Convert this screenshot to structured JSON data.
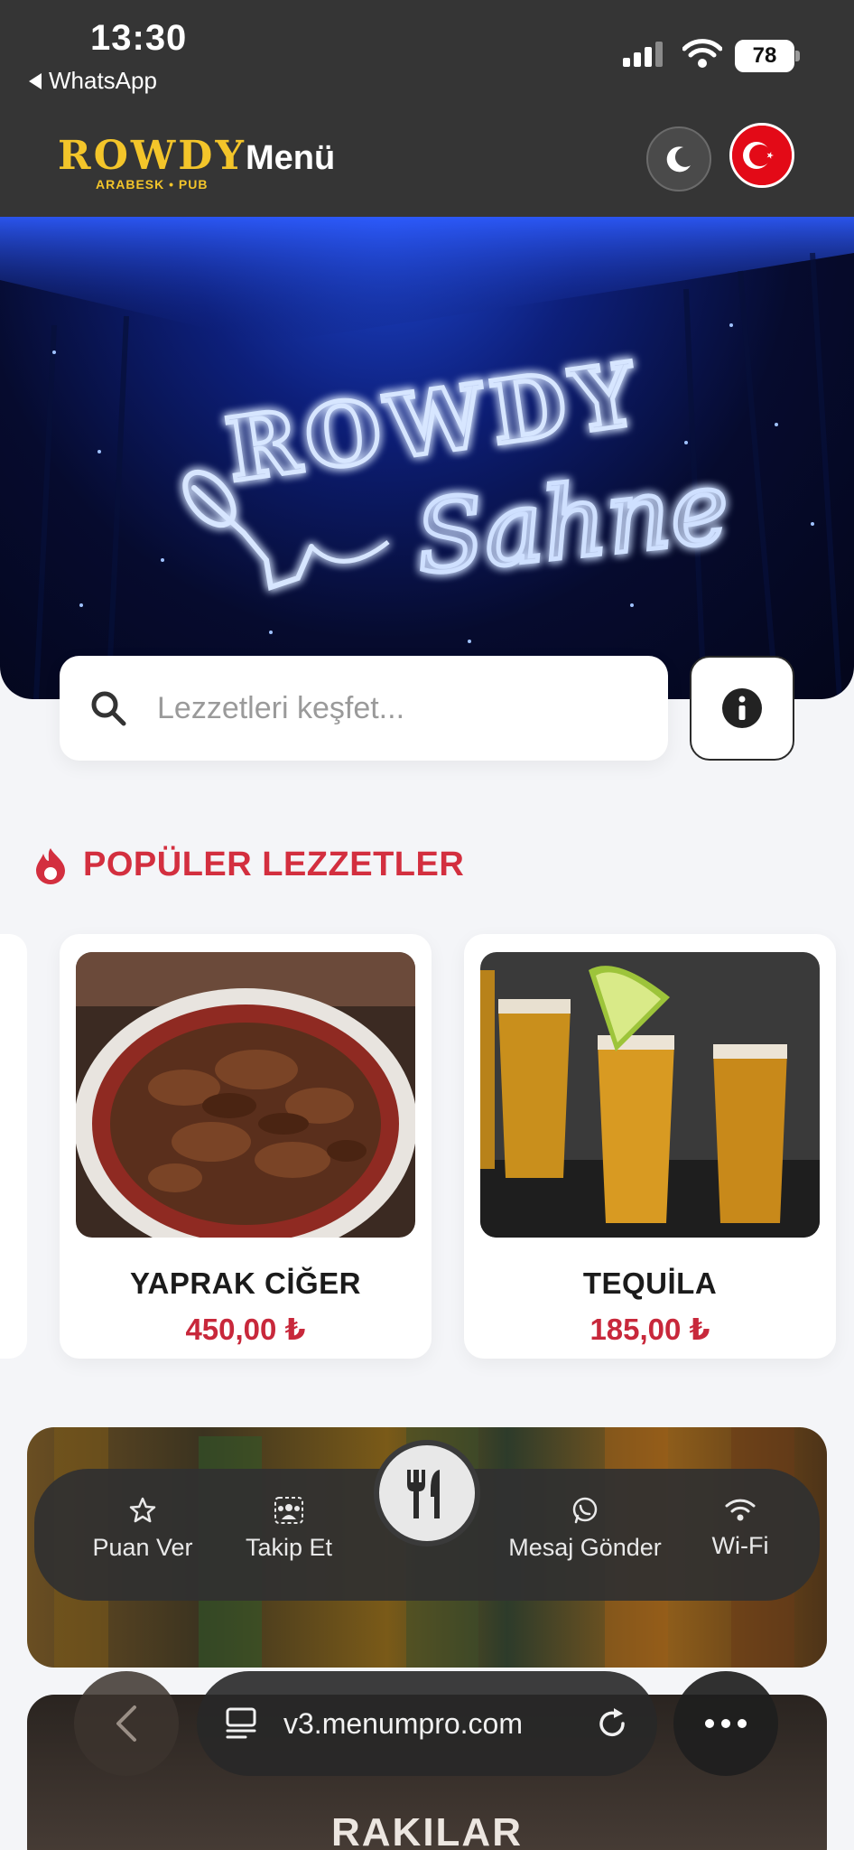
{
  "status_bar": {
    "time": "13:30",
    "back_app": "WhatsApp",
    "battery": "78"
  },
  "header": {
    "logo_text": "ROWDY",
    "logo_sub": "ARABESK • PUB",
    "title": "Menü",
    "theme_icon": "moon-icon",
    "language_icon": "turkey-flag-icon"
  },
  "hero": {
    "sign_line1": "ROWDY",
    "sign_line2": "Sahne"
  },
  "search": {
    "placeholder": "Lezzetleri keşfet...",
    "value": ""
  },
  "popular": {
    "title": "POPÜLER LEZZETLER",
    "items": [
      {
        "name": "YAPRAK CİĞER",
        "price": "450,00 ₺"
      },
      {
        "name": "TEQUİLA",
        "price": "185,00 ₺"
      }
    ]
  },
  "categories": [
    {
      "title": ""
    },
    {
      "title": "RAKILAR"
    }
  ],
  "action_bar": {
    "items": [
      {
        "label": "Puan Ver",
        "icon": "star-icon"
      },
      {
        "label": "Takip Et",
        "icon": "people-icon"
      },
      {
        "label": "Mesaj Gönder",
        "icon": "whatsapp-icon"
      },
      {
        "label": "Wi-Fi",
        "icon": "wifi-icon"
      }
    ],
    "center_icon": "fork-knife-icon"
  },
  "browser": {
    "url": "v3.menumpro.com"
  },
  "colors": {
    "accent_red": "#d32f3f",
    "price_red": "#c8283b",
    "header_bg": "#353535",
    "logo_yellow": "#f3c52a",
    "page_bg": "#f4f5f8"
  }
}
